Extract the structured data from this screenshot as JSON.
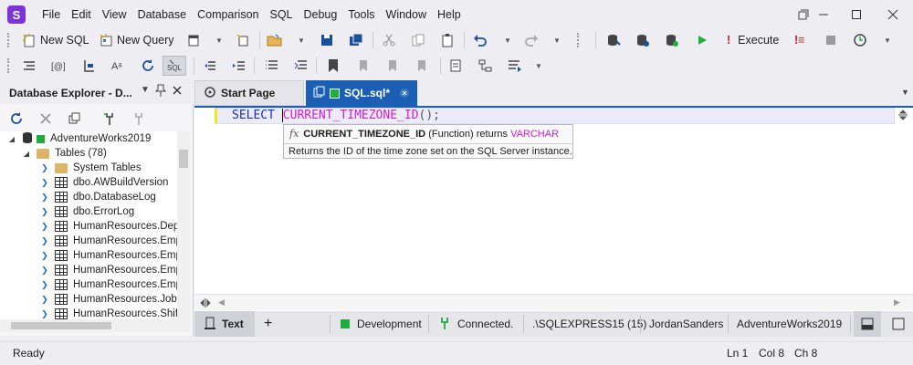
{
  "app": {
    "logo_letter": "S"
  },
  "menu": [
    "File",
    "Edit",
    "View",
    "Database",
    "Comparison",
    "SQL",
    "Debug",
    "Tools",
    "Window",
    "Help"
  ],
  "toolbar": {
    "new_sql": "New SQL",
    "new_query": "New Query",
    "execute": "Execute"
  },
  "explorer": {
    "title": "Database Explorer - D...",
    "tree": [
      {
        "label": "AdventureWorks2019",
        "kind": "database"
      },
      {
        "label": "Tables (78)",
        "kind": "folder-open"
      },
      {
        "label": "System Tables",
        "kind": "folder"
      },
      {
        "label": "dbo.AWBuildVersion",
        "kind": "table"
      },
      {
        "label": "dbo.DatabaseLog",
        "kind": "table"
      },
      {
        "label": "dbo.ErrorLog",
        "kind": "table"
      },
      {
        "label": "HumanResources.Dep",
        "kind": "table"
      },
      {
        "label": "HumanResources.Emp",
        "kind": "table"
      },
      {
        "label": "HumanResources.Emp",
        "kind": "table"
      },
      {
        "label": "HumanResources.Emp",
        "kind": "table"
      },
      {
        "label": "HumanResources.Emp",
        "kind": "table"
      },
      {
        "label": "HumanResources.Job",
        "kind": "table"
      },
      {
        "label": "HumanResources.Shif",
        "kind": "table"
      }
    ]
  },
  "tabs": [
    {
      "label": "Start Page",
      "active": false
    },
    {
      "label": "SQL.sql*",
      "active": true
    }
  ],
  "editor": {
    "keyword": "SELECT",
    "function": "CURRENT_TIMEZONE_ID",
    "punct": "();",
    "tooltip": {
      "fx": "fx",
      "name": "CURRENT_TIMEZONE_ID",
      "kind": "(Function) returns",
      "returns": "VARCHAR",
      "description": "Returns the ID of the time zone set on the SQL Server instance."
    }
  },
  "status_panel": {
    "mode": "Text",
    "add": "+",
    "environment": "Development",
    "connection": "Connected.",
    "server": ".\\SQLEXPRESS15 (15)",
    "user": "JordanSanders",
    "database": "AdventureWorks2019"
  },
  "statusbar": {
    "state": "Ready",
    "line": "Ln 1",
    "col": "Col 8",
    "ch": "Ch 8"
  },
  "colors": {
    "accent": "#1a5fb4",
    "keyword": "#1a2dbf",
    "function": "#d01fc4",
    "connected": "#1fae3c",
    "logo": "#7b35d6"
  }
}
